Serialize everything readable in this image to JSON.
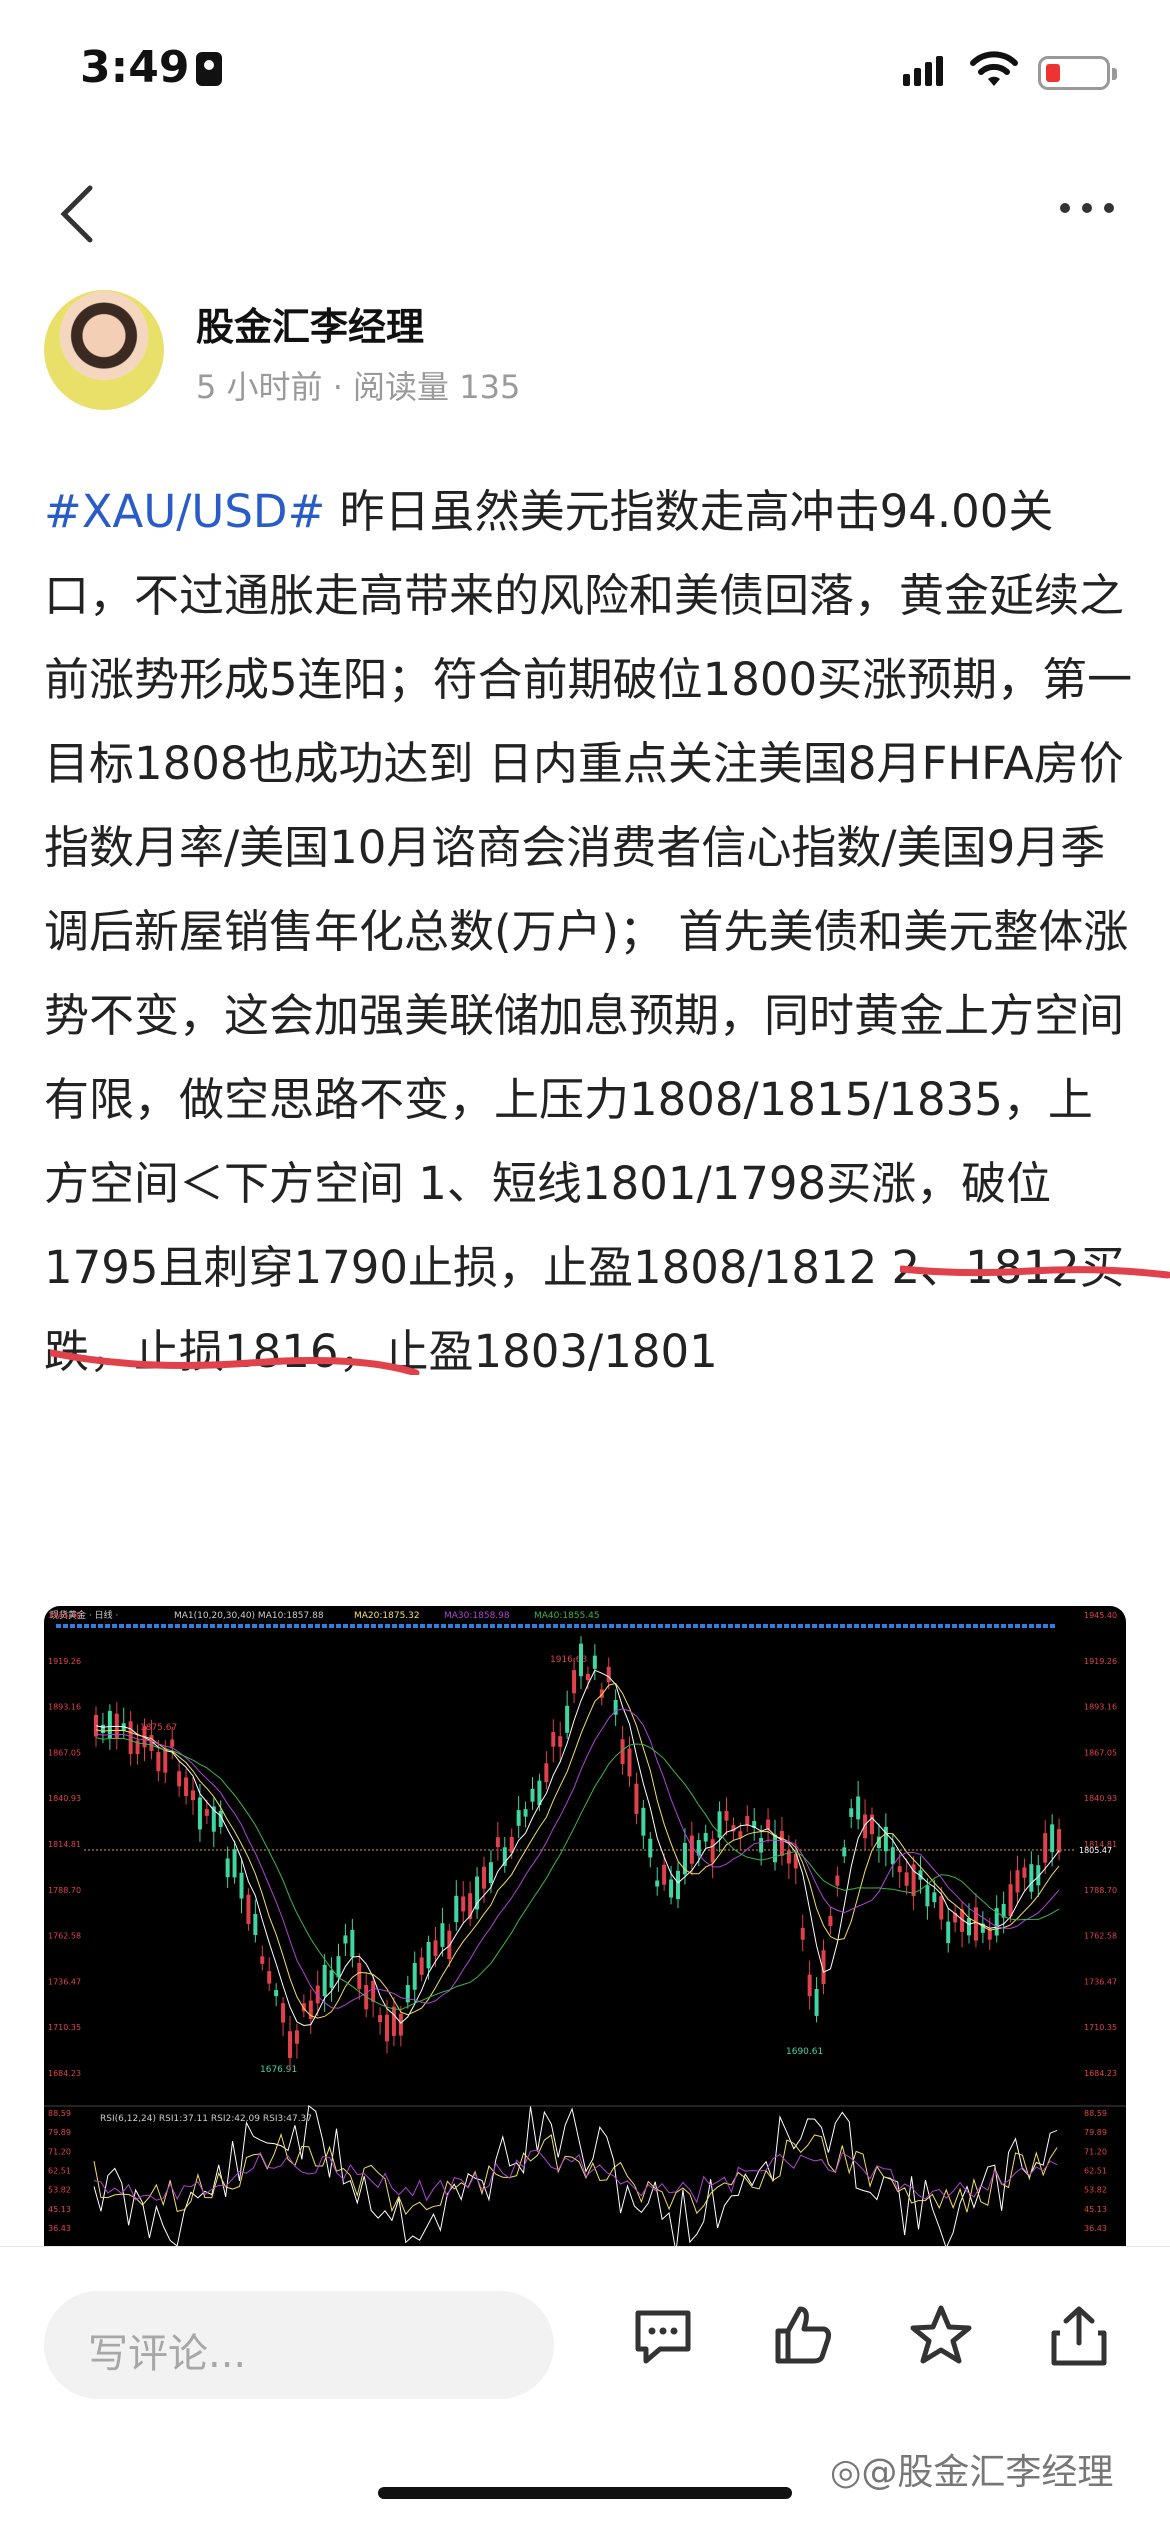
{
  "status_bar": {
    "time": "3:49"
  },
  "post": {
    "author": "股金汇李经理",
    "meta": "5 小时前 · 阅读量 135",
    "hashtag": "#XAU/USD#",
    "body": " 昨日虽然美元指数走高冲击94.00关口，不过通胀走高带来的风险和美债回落，黄金延续之前涨势形成5连阳；符合前期破位1800买涨预期，第一目标1808也成功达到 日内重点关注美国8月FHFA房价指数月率/美国10月谘商会消费者信心指数/美国9月季调后新屋销售年化总数(万户)； 首先美债和美元整体涨势不变，这会加强美联储加息预期，同时黄金上方空间有限，做空思路不变，上压力1808/1815/1835，上方空间＜下方空间 1、短线1801/1798买涨，破位1795且刺穿1790止损，止盈1808/1812 2、1812买跌，止损1816，止盈1803/1801"
  },
  "chart": {
    "header": {
      "symbol": "现货黄金 · 日线 ·",
      "ma_main": "MA1(10,20,30,40)  MA10:1857.88",
      "ma20": "MA20:1875.32",
      "ma30": "MA30:1858.98",
      "ma40": "MA40:1855.45"
    },
    "price_ticks": [
      "1945.40",
      "1919.26",
      "1893.16",
      "1867.05",
      "1840.93",
      "1814.81",
      "1788.70",
      "1762.58",
      "1736.47",
      "1710.35",
      "1684.23"
    ],
    "current_price": "1805.47",
    "annotations": {
      "high1": "1875.67",
      "high2": "1916.63",
      "low1": "1676.91",
      "low2": "1690.61"
    },
    "rsi_header": "RSI(6,12,24)  RSI1:37.11  RSI2:42.09  RSI3:47.37",
    "rsi_ticks": [
      "88.59",
      "79.89",
      "71.20",
      "62.51",
      "53.82",
      "45.13",
      "36.43"
    ],
    "colors": {
      "up": "#3fd6a2",
      "down": "#e0414b",
      "ma1": "#ffffff",
      "ma2": "#f1e05a",
      "ma3": "#b043d6",
      "ma4": "#3bb54a",
      "marker": "#2f7ee0"
    }
  },
  "bottom_bar": {
    "comment_placeholder": "写评论...",
    "icons": [
      "comment-icon",
      "thumbs-up-icon",
      "star-icon",
      "share-icon"
    ]
  },
  "watermark": "◎@股金汇李经理"
}
